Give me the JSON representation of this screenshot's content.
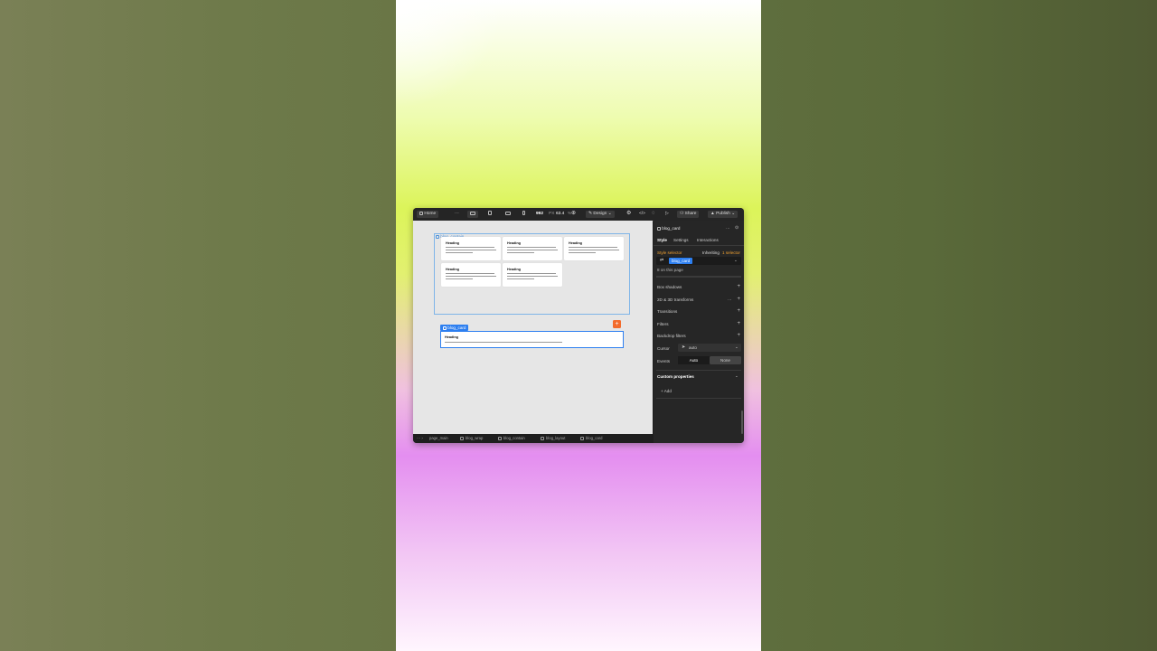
{
  "topbar": {
    "page": "Home",
    "more": "···",
    "width_value": "992",
    "unit": "PX",
    "zoom": "63.4",
    "zoom_unit": "%",
    "mode": "Design",
    "share": "Share",
    "publish": "Publish"
  },
  "canvas": {
    "container_label": "blog_contain",
    "cards": [
      {
        "heading": "Heading"
      },
      {
        "heading": "Heading"
      },
      {
        "heading": "Heading"
      },
      {
        "heading": "Heading"
      },
      {
        "heading": "Heading"
      }
    ],
    "selected": {
      "tag": "blog_card",
      "heading": "Heading"
    }
  },
  "breadcrumb": [
    "page_main",
    "blog_wrap",
    "blog_contain",
    "blog_layout",
    "blog_card"
  ],
  "panel": {
    "element": "blog_card",
    "tabs": [
      "Style",
      "Settings",
      "Interactions"
    ],
    "style_selector": "Style selector",
    "inheriting_prefix": "Inheriting",
    "inheriting_count": "1 selector",
    "selector_chip": "blog_card",
    "on_page": "8 on this page",
    "sections": [
      "Box shadows",
      "2D & 3D transforms",
      "Transitions",
      "Filters",
      "Backdrop filters"
    ],
    "cursor_label": "Cursor",
    "cursor_value": "auto",
    "events_label": "Events",
    "events_options": [
      "Auto",
      "None"
    ],
    "custom_properties": "Custom properties",
    "add": "Add"
  },
  "colors": {
    "accent": "#2d7ff0",
    "add": "#f36b2b",
    "inherit": "#f0a030"
  }
}
